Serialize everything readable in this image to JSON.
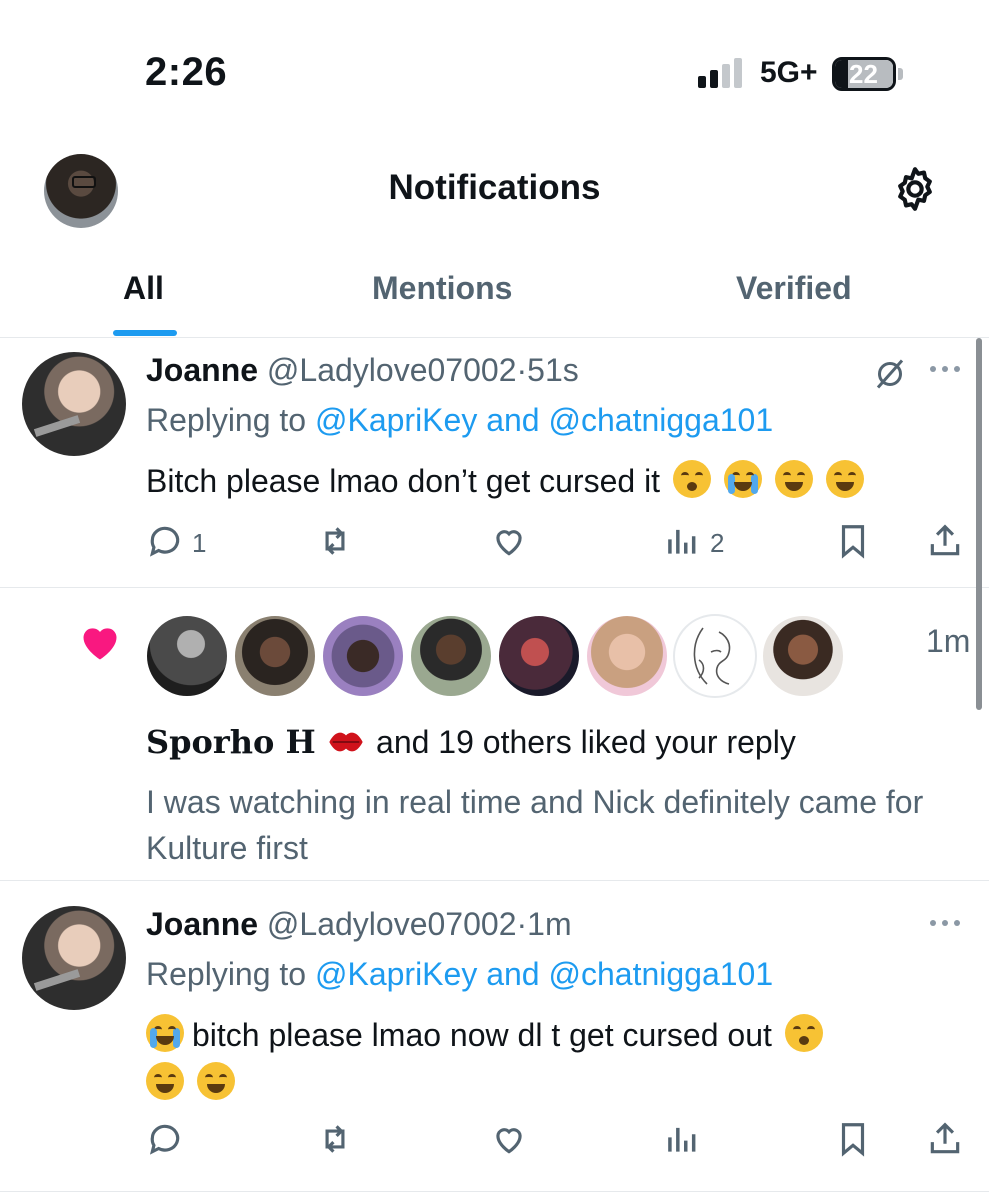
{
  "status_bar": {
    "time": "2:26",
    "network": "5G+",
    "battery_level": "22",
    "battery_fraction": 0.22,
    "signal_bars_filled": 2,
    "signal_bars_total": 4
  },
  "header": {
    "title": "Notifications",
    "avatar_icon": "profile-avatar",
    "settings_icon": "gear-icon"
  },
  "tabs": [
    {
      "label": "All",
      "active": true
    },
    {
      "label": "Mentions",
      "active": false
    },
    {
      "label": "Verified",
      "active": false
    }
  ],
  "notifications": [
    {
      "type": "reply",
      "name": "Joanne",
      "handle": "@Ladylove07002",
      "dot": "·",
      "time": "51s",
      "replying_prefix": "Replying to",
      "replying_to": "@KapriKey and @chatnigga101",
      "text": "Bitch please lmao don’t get cursed it",
      "emojis": [
        "partying-face",
        "loudly-crying-face",
        "tears-of-joy",
        "tears-of-joy"
      ],
      "reply_count": "1",
      "retweet_count": "",
      "like_count": "",
      "views_count": "2"
    },
    {
      "type": "like",
      "time": "1m",
      "liker_name": "Sporho H",
      "liker_emoji": "kiss-mark",
      "summary": "and 19 others liked your reply",
      "quoted_text": "I was watching in real time and Nick definitely came for Kulture first",
      "avatar_count": 8
    },
    {
      "type": "reply",
      "name": "Joanne",
      "handle": "@Ladylove07002",
      "dot": "·",
      "time": "1m",
      "replying_prefix": "Replying to",
      "replying_to": "@KapriKey and @chatnigga101",
      "text": "bitch please lmao now dl t get cursed out",
      "emojis": [
        "loudly-crying-face",
        "partying-face",
        "tears-of-joy",
        "tears-of-joy"
      ],
      "reply_count": "",
      "retweet_count": "",
      "like_count": "",
      "views_count": ""
    }
  ],
  "colors": {
    "accent": "#1d9bf0",
    "secondary_text": "#536471",
    "like_heart": "#f91880"
  }
}
